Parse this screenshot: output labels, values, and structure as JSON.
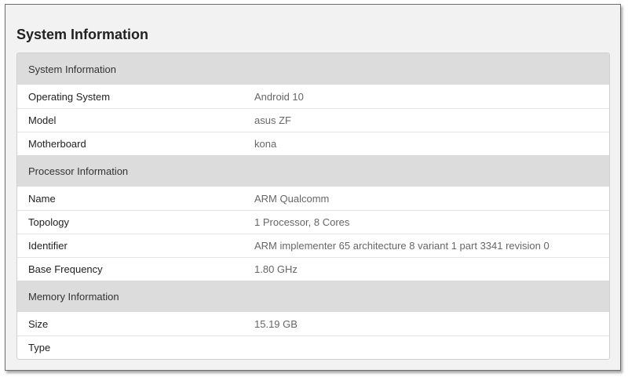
{
  "page": {
    "title": "System Information"
  },
  "sections": [
    {
      "header": "System Information",
      "rows": [
        {
          "label": "Operating System",
          "value": "Android 10"
        },
        {
          "label": "Model",
          "value": "asus ZF"
        },
        {
          "label": "Motherboard",
          "value": "kona"
        }
      ]
    },
    {
      "header": "Processor Information",
      "rows": [
        {
          "label": "Name",
          "value": "ARM Qualcomm"
        },
        {
          "label": "Topology",
          "value": "1 Processor, 8 Cores"
        },
        {
          "label": "Identifier",
          "value": "ARM implementer 65 architecture 8 variant 1 part 3341 revision 0"
        },
        {
          "label": "Base Frequency",
          "value": "1.80 GHz"
        }
      ]
    },
    {
      "header": "Memory Information",
      "rows": [
        {
          "label": "Size",
          "value": "15.19 GB"
        },
        {
          "label": "Type",
          "value": ""
        }
      ]
    }
  ]
}
